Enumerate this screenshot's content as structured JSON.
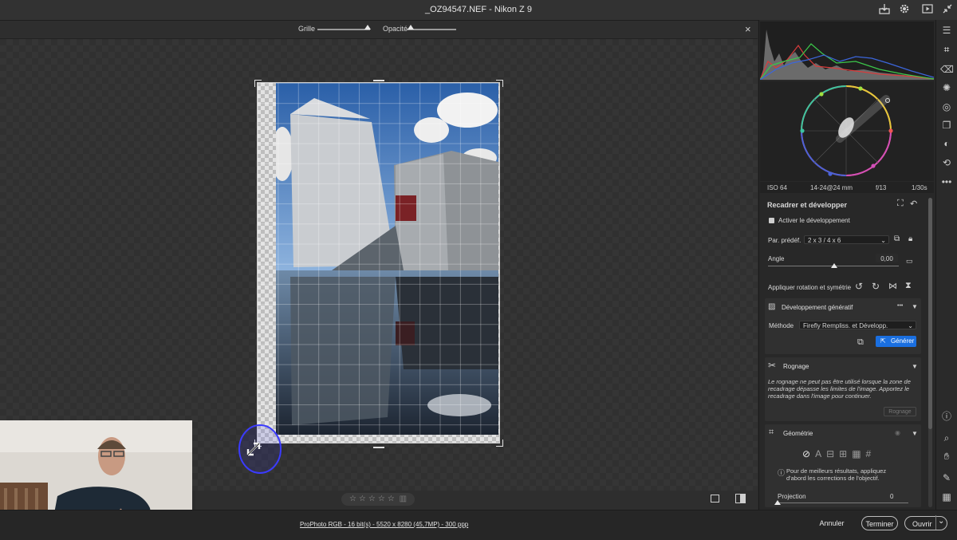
{
  "titlebar": {
    "title": "_OZ94547.NEF  -  Nikon Z 9",
    "icons": [
      "export-icon",
      "gear-icon",
      "play-icon",
      "collapse-icon"
    ]
  },
  "overlay": {
    "grid_label": "Grille",
    "opacity_label": "Opacité",
    "grid_level": 0.95,
    "opacity_level": 0.08,
    "close_glyph": "×"
  },
  "histogram": {
    "colors": {
      "red": "#d83c3c",
      "green": "#3cc84a",
      "blue": "#3c66dc"
    }
  },
  "exif": {
    "iso": "ISO 64",
    "lens": "14-24@24 mm",
    "aperture": "f/13",
    "shutter": "1/30s"
  },
  "crop_panel": {
    "title": "Recadrer et développer",
    "enable_expand_label": "Activer le développement",
    "preset_label": "Par. prédéf.",
    "preset_value": "2 x 3  / 4 x 6",
    "angle_label": "Angle",
    "angle_value": "0,00",
    "rotate_label": "Appliquer rotation et symétrie"
  },
  "gen_expand": {
    "title": "Développement génératif",
    "more_glyph": "•••",
    "method_label": "Méthode",
    "method_value": "Firefly Rempliss. et Développ.",
    "generate_label": "Générer"
  },
  "crop_section": {
    "title": "Rognage",
    "message": "Le rognage ne peut pas être utilisé lorsque la zone de recadrage dépasse les limites de l'image. Apportez le recadrage dans l'image pour continuer.",
    "button": "Rognage"
  },
  "geometry": {
    "title": "Géométrie",
    "info": "Pour de meilleurs résultats, appliquez d'abord les corrections de l'objectif.",
    "projection_label": "Projection",
    "projection_value": "0"
  },
  "status": {
    "stars": "☆☆☆☆☆",
    "profile": "ProPhoto RGB - 16 bit(s) - 5520 x 8280 (45,7MP) - 300 ppp"
  },
  "buttons": {
    "cancel": "Annuler",
    "done": "Terminer",
    "open": "Ouvrir",
    "open_caret": "⌄"
  }
}
